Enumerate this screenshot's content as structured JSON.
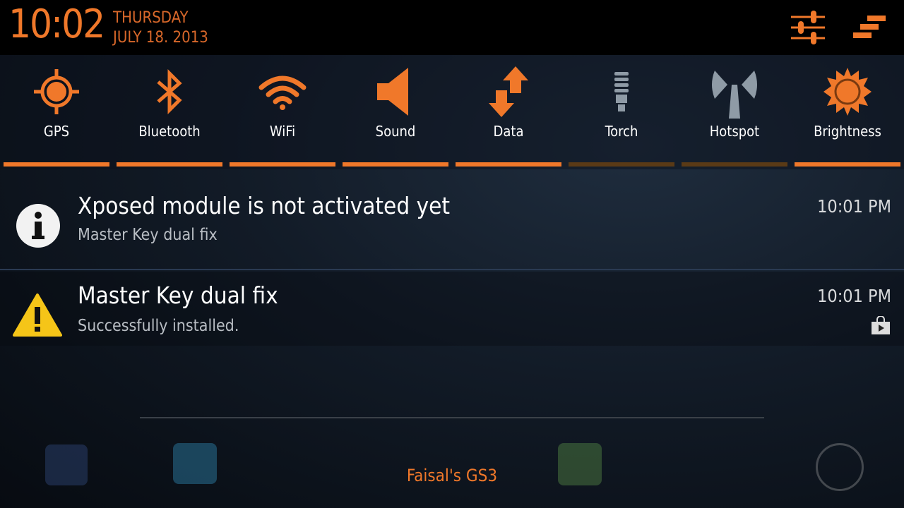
{
  "header": {
    "time": "10:02",
    "day": "THURSDAY",
    "date": "JULY 18. 2013",
    "buttons": [
      {
        "icon": "sliders-icon",
        "name": "settings-button"
      },
      {
        "icon": "clear-all-icon",
        "name": "clear-notifications-button"
      }
    ]
  },
  "toggles": [
    {
      "label": "GPS",
      "icon": "gps-icon",
      "active": true
    },
    {
      "label": "Bluetooth",
      "icon": "bluetooth-icon",
      "active": true
    },
    {
      "label": "WiFi",
      "icon": "wifi-icon",
      "active": true
    },
    {
      "label": "Sound",
      "icon": "speaker-icon",
      "active": true
    },
    {
      "label": "Data",
      "icon": "data-arrows-icon",
      "active": true
    },
    {
      "label": "Torch",
      "icon": "bulb-icon",
      "active": false
    },
    {
      "label": "Hotspot",
      "icon": "hotspot-icon",
      "active": false
    },
    {
      "label": "Brightness",
      "icon": "sun-icon",
      "active": true
    }
  ],
  "notifications": [
    {
      "title": "Xposed module is not activated yet",
      "subtitle": "Master Key dual fix",
      "time": "10:01 PM",
      "icon": "info-icon"
    },
    {
      "title": "Master Key dual fix",
      "subtitle": "Successfully installed.",
      "time": "10:01 PM",
      "icon": "warning-icon",
      "badge_icon": "play-store-bag-icon"
    }
  ],
  "footer": {
    "owner": "Faisal's GS3"
  },
  "colors": {
    "accent": "#f0782a",
    "inactive": "#5a3a16",
    "inactive_icon": "#8f9ba6"
  }
}
